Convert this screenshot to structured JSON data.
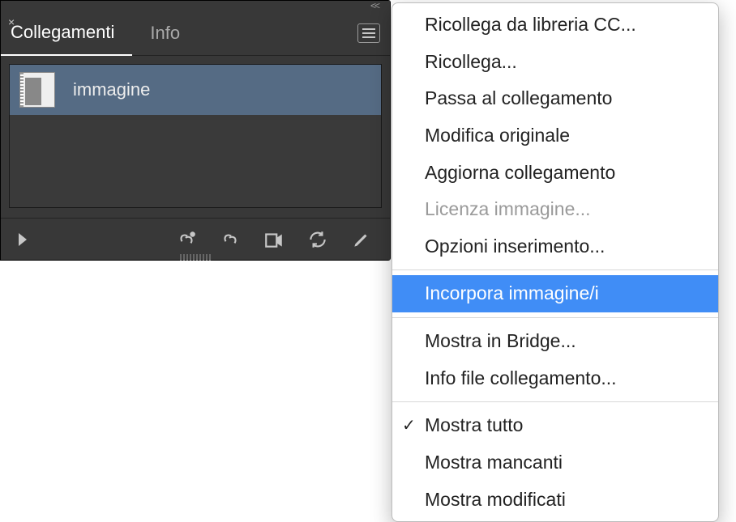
{
  "tabs": {
    "links": "Collegamenti",
    "info": "Info"
  },
  "list": {
    "item0": {
      "label": "immagine"
    }
  },
  "menu": {
    "relink_cc": "Ricollega da libreria CC...",
    "relink": "Ricollega...",
    "goto_link": "Passa al collegamento",
    "edit_original": "Modifica originale",
    "update_link": "Aggiorna collegamento",
    "license_image": "Licenza immagine...",
    "place_options": "Opzioni inserimento...",
    "embed_image": "Incorpora immagine/i",
    "show_in_bridge": "Mostra in Bridge...",
    "link_file_info": "Info file collegamento...",
    "show_all": "Mostra tutto",
    "show_missing": "Mostra mancanti",
    "show_modified": "Mostra modificati"
  },
  "icons": {
    "close": "×",
    "collapse": "<<",
    "check": "✓"
  }
}
